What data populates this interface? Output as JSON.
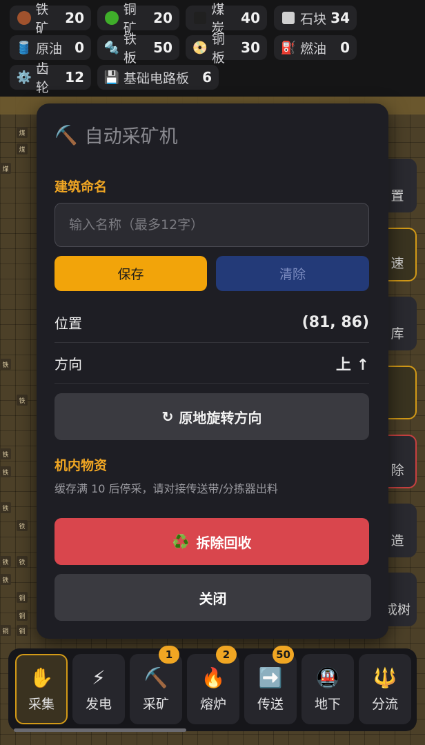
{
  "resources": [
    {
      "icon": "iron-ore-icon",
      "label": "铁矿",
      "count": "20",
      "color": "#a0522d",
      "shape": "dot"
    },
    {
      "icon": "copper-ore-icon",
      "label": "铜矿",
      "count": "20",
      "color": "#3fae2a",
      "shape": "dot"
    },
    {
      "icon": "coal-icon",
      "label": "煤炭",
      "count": "40",
      "color": "#202020",
      "shape": "sq"
    },
    {
      "icon": "stone-icon",
      "label": "石块",
      "count": "34",
      "color": "#d0d0d0",
      "shape": "sq"
    },
    {
      "icon": "crude-oil-icon",
      "label": "原油",
      "count": "0",
      "glyph": "🛢️"
    },
    {
      "icon": "iron-plate-icon",
      "label": "铁板",
      "count": "50",
      "glyph": "🔩"
    },
    {
      "icon": "copper-plate-icon",
      "label": "铜板",
      "count": "30",
      "glyph": "📀"
    },
    {
      "icon": "fuel-icon",
      "label": "燃油",
      "count": "0",
      "glyph": "⛽"
    },
    {
      "icon": "gear-icon",
      "label": "齿轮",
      "count": "12",
      "glyph": "⚙️"
    },
    {
      "icon": "circuit-board-icon",
      "label": "基础电路板",
      "count": "6",
      "glyph": "💾"
    }
  ],
  "modal": {
    "title_icon": "⛏️",
    "title": "自动采矿机",
    "name_section": "建筑命名",
    "name_placeholder": "输入名称（最多12字）",
    "save_label": "保存",
    "clear_label": "清除",
    "position_label": "位置",
    "position_value": "(81, 86)",
    "direction_label": "方向",
    "direction_value": "上 ↑",
    "rotate_icon": "↻",
    "rotate_label": "原地旋转方向",
    "inventory_section": "机内物资",
    "inventory_note": "缓存满 10 后停采，请对接传送带/分拣器出料",
    "demolish_icon": "♻️",
    "demolish_label": "拆除回收",
    "close_label": "关闭"
  },
  "side_buttons": [
    "置",
    "速",
    "库",
    "",
    "除",
    "造",
    "成树"
  ],
  "toolbar": [
    {
      "icon": "hand-icon",
      "glyph": "✋",
      "label": "采集",
      "active": true,
      "badge": ""
    },
    {
      "icon": "lightning-icon",
      "glyph": "⚡",
      "label": "发电",
      "active": false,
      "badge": ""
    },
    {
      "icon": "pickaxe-icon",
      "glyph": "⛏️",
      "label": "采矿",
      "active": false,
      "badge": "1"
    },
    {
      "icon": "fire-icon",
      "glyph": "🔥",
      "label": "熔炉",
      "active": false,
      "badge": "2"
    },
    {
      "icon": "arrow-right-icon",
      "glyph": "➡️",
      "label": "传送",
      "active": false,
      "badge": "50"
    },
    {
      "icon": "subway-icon",
      "glyph": "🚇",
      "label": "地下",
      "active": false,
      "badge": ""
    },
    {
      "icon": "trident-icon",
      "glyph": "🔱",
      "label": "分流",
      "active": false,
      "badge": ""
    }
  ],
  "colors": {
    "accent": "#f0a623",
    "save": "#f2a40a",
    "clear": "#233a78",
    "demolish": "#d9464d",
    "modal_bg": "#1e1e24"
  }
}
